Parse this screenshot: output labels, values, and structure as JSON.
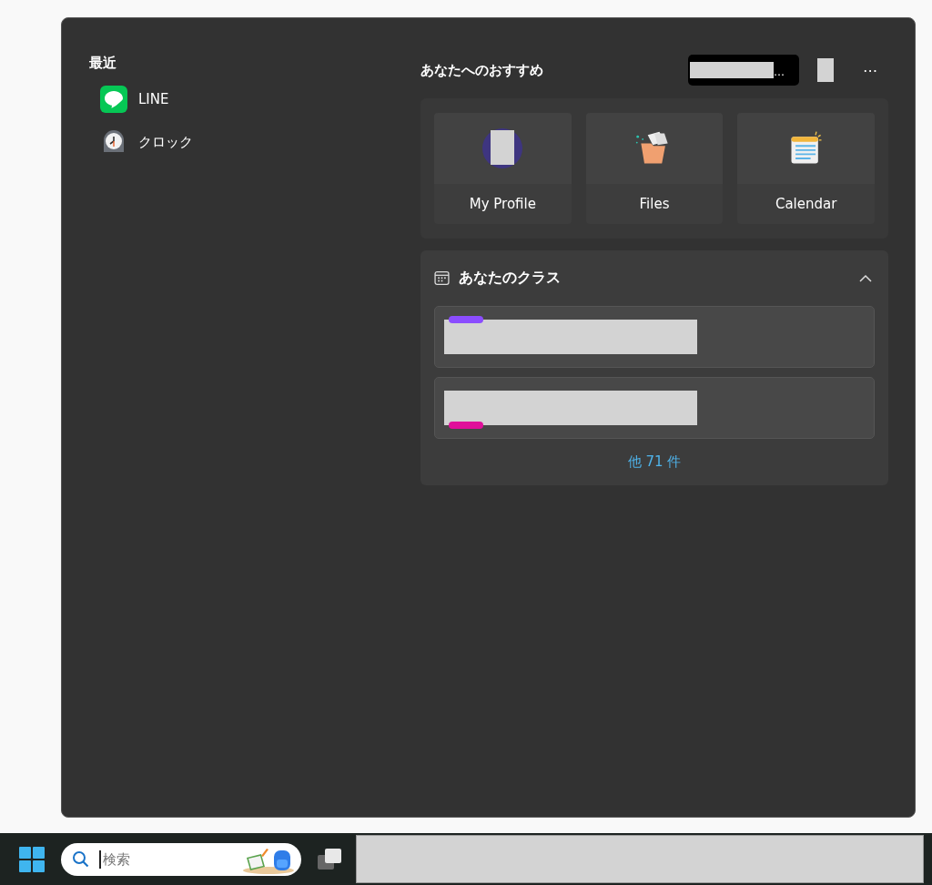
{
  "recent": {
    "title": "最近",
    "items": [
      {
        "label": "LINE",
        "kind": "line"
      },
      {
        "label": "クロック",
        "kind": "clock"
      }
    ]
  },
  "recommended": {
    "title": "あなたへのおすすめ",
    "account": {
      "overflow": "…"
    },
    "more": "⋯",
    "tiles": [
      {
        "label": "My Profile",
        "kind": "profile"
      },
      {
        "label": "Files",
        "kind": "files"
      },
      {
        "label": "Calendar",
        "kind": "calendar"
      }
    ]
  },
  "classes": {
    "title": "あなたのクラス",
    "expanded": true,
    "rows": [
      {
        "color": "#8b4dff"
      },
      {
        "color": "#e0109a"
      }
    ],
    "more_link": "他 71 件"
  },
  "taskbar": {
    "search": {
      "placeholder": "検索"
    }
  }
}
